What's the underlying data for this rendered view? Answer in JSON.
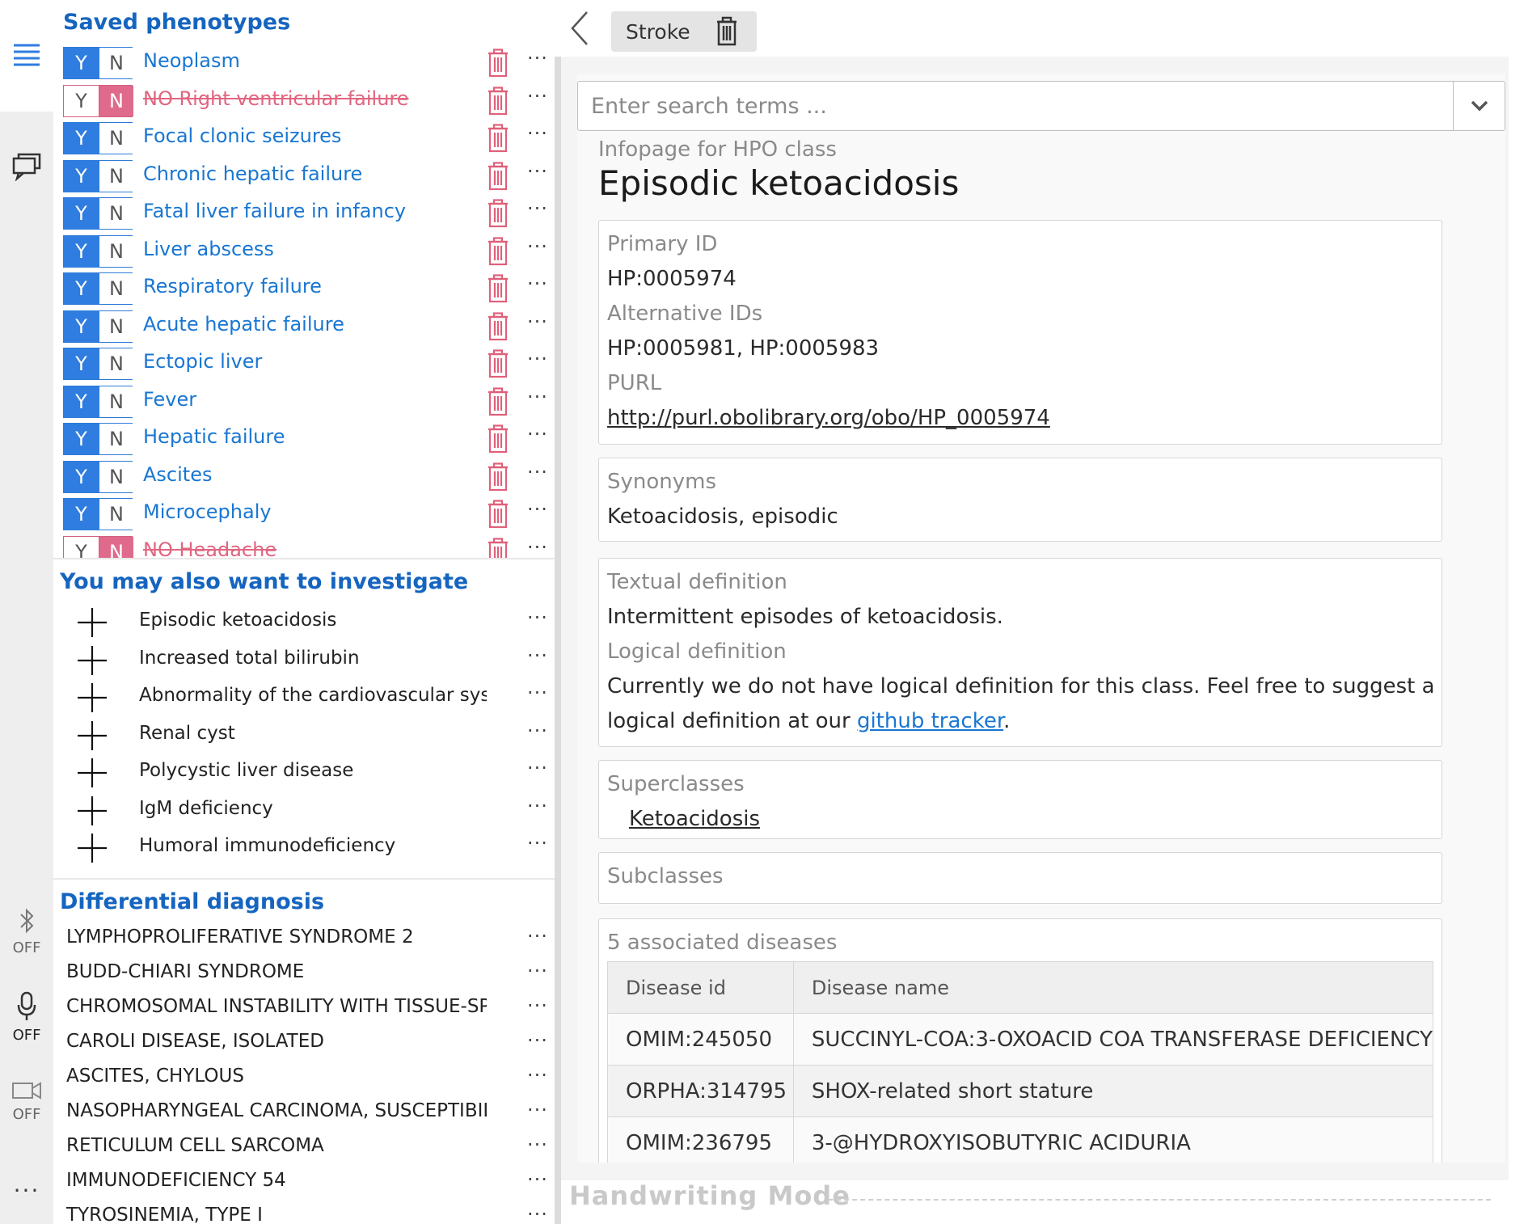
{
  "rail": {
    "bluetooth_state": "OFF",
    "mic_state": "OFF",
    "camera_state": "OFF",
    "more": "..."
  },
  "saved": {
    "title": "Saved phenotypes",
    "y": "Y",
    "n": "N",
    "items": [
      {
        "label": "Neoplasm",
        "state": "yes"
      },
      {
        "label": "NO Right ventricular failure",
        "state": "no"
      },
      {
        "label": "Focal clonic seizures",
        "state": "yes"
      },
      {
        "label": "Chronic hepatic failure",
        "state": "yes"
      },
      {
        "label": "Fatal liver failure in infancy",
        "state": "yes"
      },
      {
        "label": "Liver abscess",
        "state": "yes"
      },
      {
        "label": "Respiratory failure",
        "state": "yes"
      },
      {
        "label": "Acute hepatic failure",
        "state": "yes"
      },
      {
        "label": "Ectopic liver",
        "state": "yes"
      },
      {
        "label": "Fever",
        "state": "yes"
      },
      {
        "label": "Hepatic failure",
        "state": "yes"
      },
      {
        "label": "Ascites",
        "state": "yes"
      },
      {
        "label": "Microcephaly",
        "state": "yes"
      },
      {
        "label": "NO Headache",
        "state": "no"
      }
    ]
  },
  "suggest": {
    "title": "You may also want to investigate",
    "items": [
      "Episodic ketoacidosis",
      "Increased total bilirubin",
      "Abnormality of the cardiovascular syster",
      "Renal cyst",
      "Polycystic liver disease",
      "IgM deficiency",
      "Humoral immunodeficiency"
    ]
  },
  "dx": {
    "title": "Differential diagnosis",
    "items": [
      "LYMPHOPROLIFERATIVE SYNDROME 2",
      "BUDD-CHIARI SYNDROME",
      "CHROMOSOMAL INSTABILITY WITH TISSUE-SPE(",
      "CAROLI DISEASE, ISOLATED",
      "ASCITES, CHYLOUS",
      "NASOPHARYNGEAL CARCINOMA, SUSCEPTIBILIT",
      "RETICULUM CELL SARCOMA",
      "IMMUNODEFICIENCY 54",
      "TYROSINEMIA, TYPE I"
    ]
  },
  "toolbar": {
    "stroke_label": "Stroke"
  },
  "search": {
    "placeholder": "Enter search terms ..."
  },
  "info": {
    "subtitle": "Infopage for HPO class",
    "title": "Episodic ketoacidosis",
    "primary_id_label": "Primary ID",
    "primary_id": "HP:0005974",
    "alt_ids_label": "Alternative IDs",
    "alt_ids": "HP:0005981, HP:0005983",
    "purl_label": "PURL",
    "purl": "http://purl.obolibrary.org/obo/HP_0005974",
    "synonyms_label": "Synonyms",
    "synonyms": "Ketoacidosis, episodic",
    "textual_def_label": "Textual definition",
    "textual_def": "Intermittent episodes of ketoacidosis.",
    "logical_def_label": "Logical definition",
    "logical_def_line1": "Currently we do not have logical definition for this class. Feel free to suggest a",
    "logical_def_line2_pre": "logical definition at our ",
    "logical_def_link": "github tracker",
    "logical_def_line2_post": ".",
    "superclasses_label": "Superclasses",
    "superclass": "Ketoacidosis",
    "subclasses_label": "Subclasses",
    "diseases_label": "5 associated diseases",
    "col_id": "Disease id",
    "col_name": "Disease name",
    "diseases": [
      {
        "id": "OMIM:245050",
        "name": "SUCCINYL-COA:3-OXOACID COA TRANSFERASE DEFICIENCY"
      },
      {
        "id": "ORPHA:314795",
        "name": "SHOX-related short stature"
      },
      {
        "id": "OMIM:236795",
        "name": "3-@HYDROXYISOBUTYRIC ACIDURIA"
      }
    ]
  },
  "footer": {
    "handwriting_mode": "Handwriting Mode"
  }
}
